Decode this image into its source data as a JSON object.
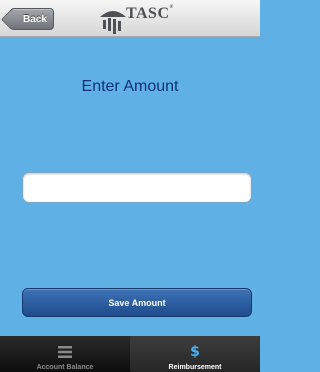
{
  "navbar": {
    "back_label": "Back",
    "logo_text": "TASC",
    "logo_mark": "®"
  },
  "main": {
    "title": "Enter Amount",
    "amount_value": "",
    "amount_placeholder": "",
    "save_label": "Save Amount"
  },
  "tabbar": {
    "tabs": [
      {
        "label": "Account Balance",
        "icon": "list-icon",
        "active": false
      },
      {
        "label": "Reimbursement",
        "icon": "dollar-icon",
        "active": true
      }
    ]
  },
  "colors": {
    "background": "#5fb1e5",
    "title": "#11307a",
    "save_button": "#2a5ea3",
    "tab_active_icon": "#4ab0f0"
  }
}
